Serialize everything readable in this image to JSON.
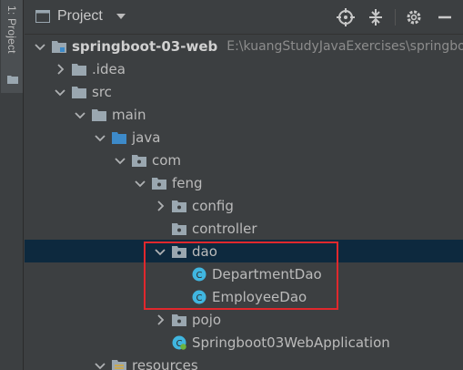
{
  "side_panel": {
    "tab_label": "1: Project"
  },
  "toolbar": {
    "title": "Project",
    "buttons": [
      "locate-icon",
      "collapse-icon",
      "settings-icon",
      "hide-icon"
    ]
  },
  "tree": {
    "root": {
      "label": "springboot-03-web",
      "path": "E:\\kuangStudyJavaExercises\\springbo"
    },
    "idea": "idea",
    "src": "src",
    "main": "main",
    "java": "java",
    "com": "com",
    "feng": "feng",
    "config": "config",
    "controller": "controller",
    "dao": "dao",
    "department_dao": "DepartmentDao",
    "employee_dao": "EmployeeDao",
    "pojo": "pojo",
    "app": "Springboot03WebApplication",
    "resources": "resources"
  },
  "colors": {
    "background": "#3c3f41",
    "selection": "#0d293e",
    "folder": "#9aa7b0",
    "source_folder": "#3d8ac9",
    "class_icon": "#40b6e0",
    "highlight": "#e0282d"
  }
}
